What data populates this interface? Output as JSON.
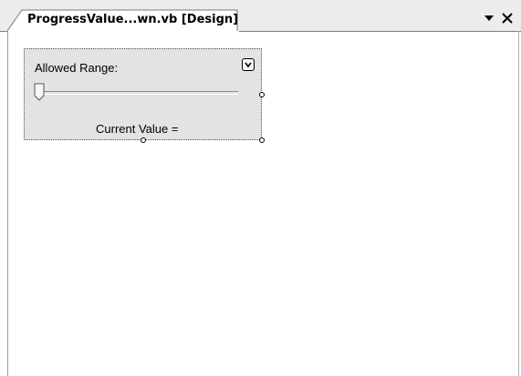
{
  "tab": {
    "title": "ProgressValue...wn.vb [Design]"
  },
  "window_controls": {
    "dropdown_icon": "chevron-down-icon",
    "close_icon": "close-icon"
  },
  "designer": {
    "allowed_range_label": "Allowed Range:",
    "current_value_label": "Current Value =",
    "smart_tag_icon": "smart-tag-icon",
    "slider": {
      "value": 0
    }
  }
}
